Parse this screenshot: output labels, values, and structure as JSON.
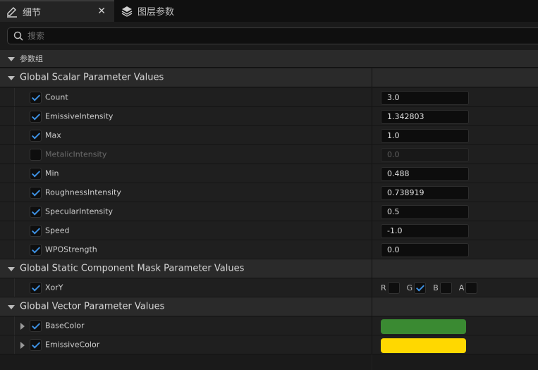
{
  "tabs": [
    {
      "label": "细节",
      "icon": "pencil-icon",
      "active": true
    },
    {
      "label": "图层参数",
      "icon": "layers-icon",
      "active": false
    }
  ],
  "search": {
    "placeholder": "搜索"
  },
  "group_label": "参数组",
  "categories": {
    "scalar": {
      "label": "Global Scalar Parameter Values",
      "params": [
        {
          "name": "Count",
          "value": "3.0",
          "enabled": true
        },
        {
          "name": "EmissiveIntensity",
          "value": "1.342803",
          "enabled": true
        },
        {
          "name": "Max",
          "value": "1.0",
          "enabled": true
        },
        {
          "name": "MetalicIntensity",
          "value": "0.0",
          "enabled": false
        },
        {
          "name": "Min",
          "value": "0.488",
          "enabled": true
        },
        {
          "name": "RoughnessIntensity",
          "value": "0.738919",
          "enabled": true
        },
        {
          "name": "SpecularIntensity",
          "value": "0.5",
          "enabled": true
        },
        {
          "name": "Speed",
          "value": "-1.0",
          "enabled": true
        },
        {
          "name": "WPOStrength",
          "value": "0.0",
          "enabled": true
        }
      ]
    },
    "mask": {
      "label": "Global Static Component Mask Parameter Values",
      "params": [
        {
          "name": "XorY",
          "enabled": true,
          "channels": [
            {
              "label": "R",
              "checked": false
            },
            {
              "label": "G",
              "checked": true
            },
            {
              "label": "B",
              "checked": false
            },
            {
              "label": "A",
              "checked": false
            }
          ]
        }
      ]
    },
    "vector": {
      "label": "Global Vector Parameter Values",
      "params": [
        {
          "name": "BaseColor",
          "enabled": true,
          "color": "#3a8a32"
        },
        {
          "name": "EmissiveColor",
          "enabled": true,
          "color": "#ffd800"
        }
      ]
    }
  },
  "colors": {
    "accent_check": "#3d8fe0"
  }
}
